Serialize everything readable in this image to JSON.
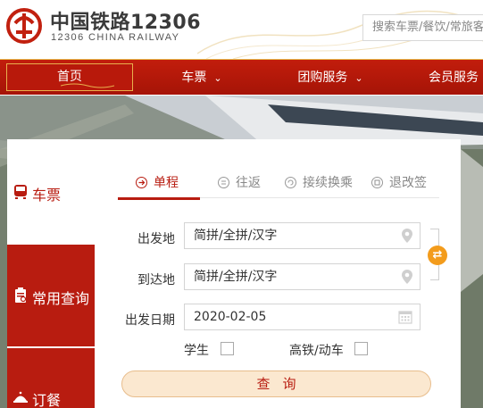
{
  "header": {
    "logo_cn": "中国铁路12306",
    "logo_en": "12306 CHINA RAILWAY",
    "search_placeholder": "搜索车票/餐饮/常旅客"
  },
  "nav": {
    "home": "首页",
    "tickets": "车票",
    "group": "团购服务",
    "member": "会员服务",
    "caret": "⌄"
  },
  "sidebar": {
    "items": [
      {
        "label": "车票",
        "icon": "train-icon",
        "active": true
      },
      {
        "label": "常用查询",
        "icon": "clipboard-icon",
        "active": false
      },
      {
        "label": "订餐",
        "icon": "meal-icon",
        "active": false
      }
    ]
  },
  "tabs": [
    {
      "label": "单程",
      "icon": "arrow-right-circle-icon",
      "active": true
    },
    {
      "label": "往返",
      "icon": "equals-circle-icon",
      "active": false
    },
    {
      "label": "接续换乘",
      "icon": "transfer-circle-icon",
      "active": false
    },
    {
      "label": "退改签",
      "icon": "refund-circle-icon",
      "active": false
    }
  ],
  "form": {
    "from_label": "出发地",
    "from_placeholder": "简拼/全拼/汉字",
    "to_label": "到达地",
    "to_placeholder": "简拼/全拼/汉字",
    "date_label": "出发日期",
    "date_value": "2020-02-05",
    "student_label": "学生",
    "student_checked": false,
    "gd_label": "高铁/动车",
    "gd_checked": false,
    "query_label": "查询",
    "swap_glyph": "⇄"
  },
  "colors": {
    "brand_red": "#b81c10",
    "gold": "#e8b04d",
    "swap_orange": "#f39c1c"
  }
}
